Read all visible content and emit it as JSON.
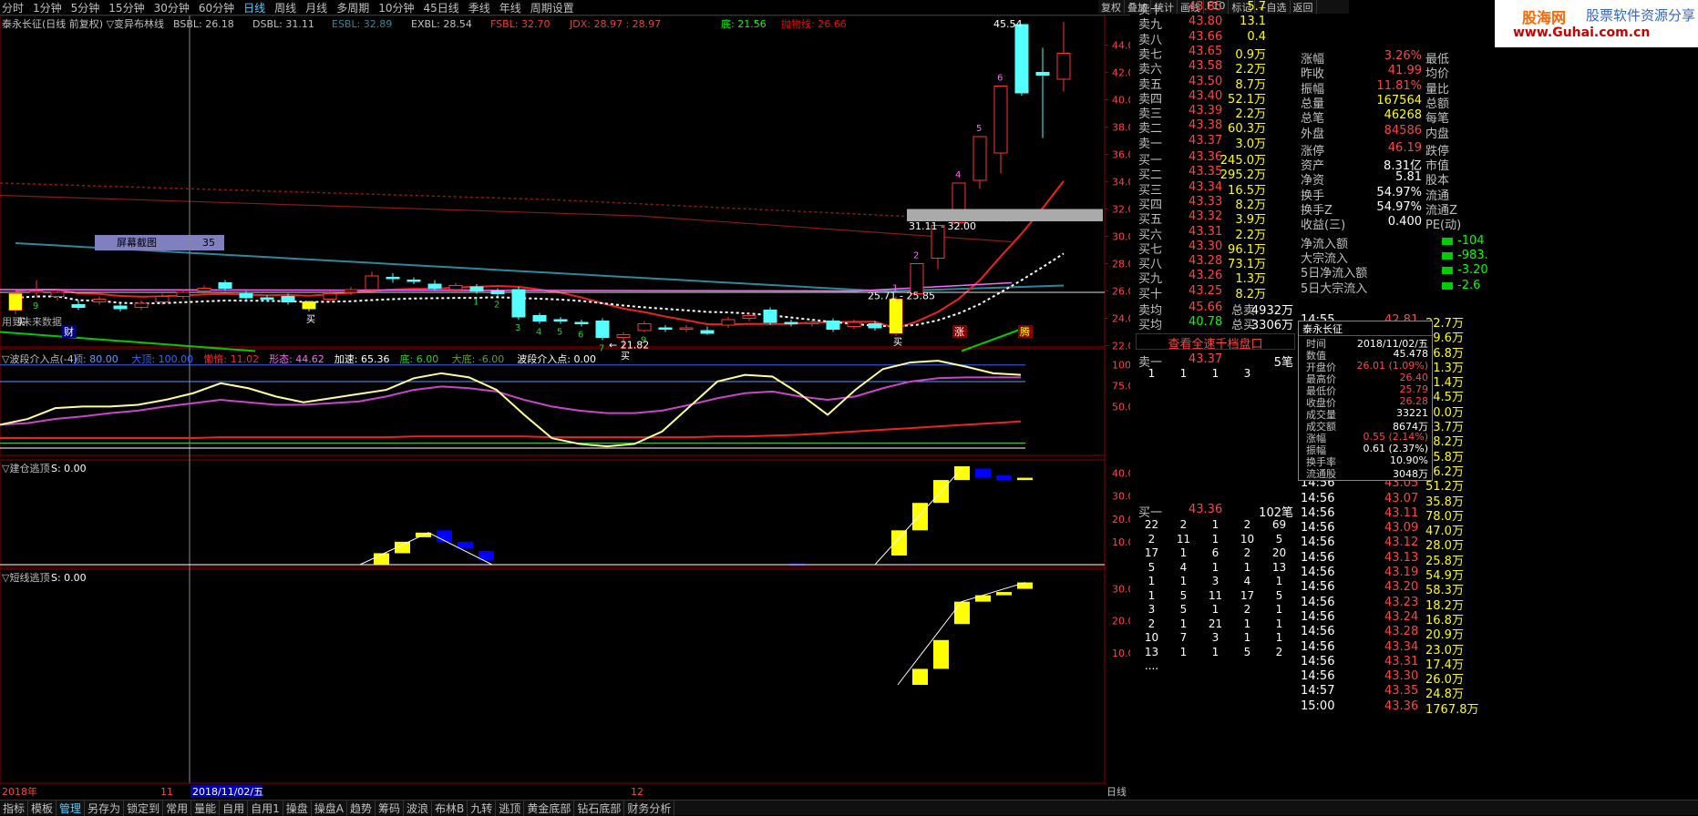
{
  "periods": [
    "分时",
    "1分钟",
    "5分钟",
    "15分钟",
    "30分钟",
    "60分钟",
    "日线",
    "周线",
    "月线",
    "多周期",
    "10分钟",
    "45日线",
    "季线",
    "年线",
    "周期设置"
  ],
  "active_period": "日线",
  "topright": [
    "复权",
    "叠加",
    "统计",
    "画线",
    "F10",
    "标记",
    "+自选",
    "返回"
  ],
  "brand": {
    "name": "股海网",
    "slogan": "股票软件资源分享",
    "url": "www.Guhai.com.cn"
  },
  "main_chart": {
    "title": "泰永长征(日线 前复权)",
    "indicator": "▽变异布林线",
    "values": [
      {
        "t": "BSBL: 26.18",
        "c": "#c0c0c0"
      },
      {
        "t": "DSBL: 31.11",
        "c": "#c0c0c0"
      },
      {
        "t": "ESBL: 32.89",
        "c": "#2a8a9a"
      },
      {
        "t": "EXBL: 28.54",
        "c": "#c0c0c0"
      },
      {
        "t": "FSBL: 32.70",
        "c": "#f33"
      },
      {
        "t": "JDX: 28.97 : 28.97",
        "c": "#d44"
      },
      {
        "t": "底: 21.56",
        "c": "#0f0"
      },
      {
        "t": "抛物线: 26.66",
        "c": "#f00"
      }
    ],
    "price_labels": [
      "44.00",
      "42.00",
      "40.00",
      "38.00",
      "36.00",
      "34.00",
      "32.00",
      "30.00",
      "28.00",
      "26.00",
      "24.00",
      "22.00"
    ],
    "annotations": {
      "high": "45.54",
      "low": "21.82",
      "band1": "31.11 - 32.00",
      "band2": "25.71 - 25.85",
      "screenshot_tool": "屏幕截图",
      "screenshot_val": "35",
      "future": "用到未来数据",
      "zhang": "涨",
      "teng": "腾",
      "cai": "财",
      "buy": "买"
    }
  },
  "chart_data": [
    {
      "type": "candlestick",
      "title": "泰永长征(日线 前复权)",
      "ylim": [
        21.5,
        45.5
      ],
      "candles": [
        {
          "o": 24.6,
          "c": 25.8,
          "h": 26.0,
          "l": 24.3
        },
        {
          "o": 25.9,
          "c": 26.0,
          "h": 26.8,
          "l": 25.5
        },
        {
          "o": 25.6,
          "c": 25.9,
          "h": 26.1,
          "l": 25.3
        },
        {
          "o": 25.0,
          "c": 24.8,
          "h": 25.3,
          "l": 24.6
        },
        {
          "o": 25.2,
          "c": 25.4,
          "h": 25.6,
          "l": 25.0
        },
        {
          "o": 24.9,
          "c": 24.7,
          "h": 25.1,
          "l": 24.5
        },
        {
          "o": 24.8,
          "c": 25.1,
          "h": 25.3,
          "l": 24.6
        },
        {
          "o": 25.2,
          "c": 25.6,
          "h": 25.8,
          "l": 25.0
        },
        {
          "o": 25.6,
          "c": 25.9,
          "h": 26.1,
          "l": 25.4
        },
        {
          "o": 26.0,
          "c": 26.2,
          "h": 26.4,
          "l": 25.8
        },
        {
          "o": 26.6,
          "c": 26.2,
          "h": 26.8,
          "l": 26.0
        },
        {
          "o": 25.8,
          "c": 25.5,
          "h": 26.0,
          "l": 25.2
        },
        {
          "o": 25.5,
          "c": 25.4,
          "h": 25.7,
          "l": 25.2
        },
        {
          "o": 25.6,
          "c": 25.2,
          "h": 25.8,
          "l": 25.0
        },
        {
          "o": 25.2,
          "c": 24.7,
          "h": 25.3,
          "l": 24.5
        },
        {
          "o": 25.4,
          "c": 25.8,
          "h": 26.0,
          "l": 25.2
        },
        {
          "o": 25.9,
          "c": 26.1,
          "h": 26.3,
          "l": 25.7
        },
        {
          "o": 26.1,
          "c": 27.1,
          "h": 27.4,
          "l": 26.0
        },
        {
          "o": 27.0,
          "c": 26.9,
          "h": 27.3,
          "l": 26.6
        },
        {
          "o": 26.8,
          "c": 26.7,
          "h": 27.0,
          "l": 26.5
        },
        {
          "o": 26.5,
          "c": 26.2,
          "h": 26.8,
          "l": 26.0
        },
        {
          "o": 26.1,
          "c": 26.4,
          "h": 26.6,
          "l": 25.9
        },
        {
          "o": 26.3,
          "c": 26.0,
          "h": 26.5,
          "l": 25.8
        },
        {
          "o": 26.0,
          "c": 25.8,
          "h": 26.2,
          "l": 25.6
        },
        {
          "o": 26.1,
          "c": 24.1,
          "h": 26.3,
          "l": 23.9
        },
        {
          "o": 24.2,
          "c": 23.8,
          "h": 24.4,
          "l": 23.6
        },
        {
          "o": 23.9,
          "c": 23.8,
          "h": 24.1,
          "l": 23.6
        },
        {
          "o": 23.7,
          "c": 23.6,
          "h": 23.9,
          "l": 23.4
        },
        {
          "o": 23.8,
          "c": 22.6,
          "h": 24.0,
          "l": 22.4
        },
        {
          "o": 22.6,
          "c": 22.8,
          "h": 23.0,
          "l": 21.8
        },
        {
          "o": 23.1,
          "c": 23.6,
          "h": 23.8,
          "l": 23.0
        },
        {
          "o": 23.3,
          "c": 23.2,
          "h": 23.5,
          "l": 23.0
        },
        {
          "o": 23.2,
          "c": 23.3,
          "h": 23.5,
          "l": 23.0
        },
        {
          "o": 23.1,
          "c": 22.9,
          "h": 23.4,
          "l": 22.8
        },
        {
          "o": 23.5,
          "c": 23.9,
          "h": 24.1,
          "l": 23.3
        },
        {
          "o": 24.0,
          "c": 24.2,
          "h": 24.4,
          "l": 23.8
        },
        {
          "o": 24.6,
          "c": 23.7,
          "h": 24.8,
          "l": 23.5
        },
        {
          "o": 23.7,
          "c": 23.6,
          "h": 23.9,
          "l": 23.4
        },
        {
          "o": 23.6,
          "c": 23.7,
          "h": 23.9,
          "l": 23.4
        },
        {
          "o": 23.8,
          "c": 23.2,
          "h": 24.0,
          "l": 23.0
        },
        {
          "o": 23.4,
          "c": 23.7,
          "h": 23.9,
          "l": 23.2
        },
        {
          "o": 23.6,
          "c": 23.3,
          "h": 23.8,
          "l": 23.1
        },
        {
          "o": 22.9,
          "c": 25.4,
          "h": 25.6,
          "l": 22.7
        },
        {
          "o": 25.8,
          "c": 28.0,
          "h": 28.0,
          "l": 25.8
        },
        {
          "o": 28.4,
          "c": 30.8,
          "h": 30.8,
          "l": 27.6
        },
        {
          "o": 31.0,
          "c": 33.9,
          "h": 33.9,
          "l": 30.7
        },
        {
          "o": 34.1,
          "c": 37.3,
          "h": 37.3,
          "l": 33.5
        },
        {
          "o": 36.1,
          "c": 41.0,
          "h": 41.0,
          "l": 34.6
        },
        {
          "o": 45.5,
          "c": 40.5,
          "h": 45.5,
          "l": 40.3
        },
        {
          "o": 42.0,
          "c": 41.8,
          "h": 43.8,
          "l": 37.2
        },
        {
          "o": 41.5,
          "c": 43.4,
          "h": 45.7,
          "l": 40.6
        }
      ]
    },
    {
      "type": "line",
      "title": "波段介入点(-4)",
      "ylim": [
        0,
        115
      ],
      "ticks": [
        "100.00",
        "75.00",
        "50.00"
      ]
    },
    {
      "type": "bar",
      "title": "建仓逃顶",
      "ylim": [
        0,
        45
      ],
      "ticks": [
        "40.00",
        "30.00",
        "20.00",
        "10.00"
      ]
    },
    {
      "type": "bar",
      "title": "短线逃顶",
      "ylim": [
        0,
        35
      ],
      "ticks": [
        "30.00",
        "20.00",
        "10.00"
      ]
    }
  ],
  "panel2": {
    "title": "▽波段介入点(-4)",
    "values": [
      {
        "t": "顶: 80.00",
        "c": "#69f"
      },
      {
        "t": "大顶: 100.00",
        "c": "#36f"
      },
      {
        "t": "懒惰: 11.02",
        "c": "#f22"
      },
      {
        "t": "形态: 44.62",
        "c": "#f6f"
      },
      {
        "t": "加速: 65.36",
        "c": "#fff"
      },
      {
        "t": "底: 6.00",
        "c": "#3c3"
      },
      {
        "t": "大底: -6.00",
        "c": "#693"
      },
      {
        "t": "波段介入点: 0.00",
        "c": "#fff"
      }
    ]
  },
  "panel3": {
    "title": "▽建仓逃顶",
    "sval": "S: 0.00"
  },
  "panel4": {
    "title": "▽短线逃顶",
    "sval": "S: 0.00"
  },
  "time_axis": [
    "2018年",
    "11",
    "2018/11/02/五",
    "12",
    "日线"
  ],
  "bottom_tabs": [
    "指标",
    "模板",
    "管理",
    "另存为",
    "锁定到",
    "常用",
    "量能",
    "自用",
    "自用1",
    "操盘",
    "操盘A",
    "趋势",
    "筹码",
    "波浪",
    "布林B",
    "九转",
    "逃顶",
    "黄金底部",
    "钻石底部",
    "财务分析"
  ],
  "active_tab": "管理",
  "orderbook": {
    "sell": [
      {
        "l": "卖十",
        "p": "43.85",
        "v": "5.7"
      },
      {
        "l": "卖九",
        "p": "43.80",
        "v": "13.1"
      },
      {
        "l": "卖八",
        "p": "43.66",
        "v": "0.4"
      },
      {
        "l": "卖七",
        "p": "43.65",
        "v": "0.9万"
      },
      {
        "l": "卖六",
        "p": "43.58",
        "v": "2.2万"
      },
      {
        "l": "卖五",
        "p": "43.50",
        "v": "8.7万"
      },
      {
        "l": "卖四",
        "p": "43.40",
        "v": "52.1万"
      },
      {
        "l": "卖三",
        "p": "43.39",
        "v": "2.2万"
      },
      {
        "l": "卖二",
        "p": "43.38",
        "v": "60.3万"
      },
      {
        "l": "卖一",
        "p": "43.37",
        "v": "3.0万"
      }
    ],
    "buy": [
      {
        "l": "买一",
        "p": "43.36",
        "v": "245.0万"
      },
      {
        "l": "买二",
        "p": "43.35",
        "v": "295.2万"
      },
      {
        "l": "买三",
        "p": "43.34",
        "v": "16.5万"
      },
      {
        "l": "买四",
        "p": "43.33",
        "v": "8.2万"
      },
      {
        "l": "买五",
        "p": "43.32",
        "v": "3.9万"
      },
      {
        "l": "买六",
        "p": "43.31",
        "v": "2.2万"
      },
      {
        "l": "买七",
        "p": "43.30",
        "v": "96.1万"
      },
      {
        "l": "买八",
        "p": "43.28",
        "v": "73.1万"
      },
      {
        "l": "买九",
        "p": "43.26",
        "v": "1.3万"
      },
      {
        "l": "买十",
        "p": "43.25",
        "v": "8.2万"
      }
    ],
    "avg_sell": {
      "l": "卖均",
      "p": "45.66",
      "k": "总卖",
      "v": "4932万"
    },
    "avg_buy": {
      "l": "买均",
      "p": "40.78",
      "k": "总买",
      "v": "3306万"
    },
    "full_btn": "查看全速千档盘口",
    "sell1": {
      "l": "卖一",
      "p": "43.37",
      "v": "5笔"
    },
    "sell1_grid": [
      "1",
      "1",
      "1",
      "3",
      ""
    ],
    "buy1": {
      "l": "买一",
      "p": "43.36",
      "v": "102笔"
    },
    "buy1_grid": [
      [
        "22",
        "2",
        "1",
        "2",
        "69"
      ],
      [
        "2",
        "11",
        "1",
        "10",
        "5"
      ],
      [
        "17",
        "1",
        "6",
        "2",
        "20"
      ],
      [
        "5",
        "4",
        "1",
        "1",
        "13"
      ],
      [
        "1",
        "1",
        "3",
        "4",
        "1"
      ],
      [
        "1",
        "5",
        "11",
        "17",
        "5"
      ],
      [
        "3",
        "5",
        "1",
        "2",
        "1"
      ],
      [
        "2",
        "1",
        "21",
        "1",
        "1"
      ],
      [
        "10",
        "7",
        "3",
        "1",
        "1"
      ],
      [
        "13",
        "1",
        "1",
        "5",
        "2"
      ],
      [
        "....",
        "",
        "",
        "",
        ""
      ]
    ]
  },
  "stock_info": [
    {
      "k": "涨幅",
      "v": "3.26%",
      "k2": "最低"
    },
    {
      "k": "昨收",
      "v": "41.99",
      "k2": "均价"
    },
    {
      "k": "振幅",
      "v": "11.81%",
      "k2": "量比"
    },
    {
      "k": "总量",
      "v": "167564",
      "k2": "总额"
    },
    {
      "k": "总笔",
      "v": "46268",
      "k2": "每笔"
    },
    {
      "k": "外盘",
      "v": "84586",
      "k2": "内盘"
    },
    {
      "k": "涨停",
      "v": "46.19",
      "k2": "跌停"
    },
    {
      "k": "资产",
      "v": "8.31亿",
      "k2": "市值"
    },
    {
      "k": "净资",
      "v": "5.81",
      "k2": "股本"
    },
    {
      "k": "换手",
      "v": "54.97%",
      "k2": "流通"
    },
    {
      "k": "换手Z",
      "v": "54.97%",
      "k2": "流通Z"
    },
    {
      "k": "收益(三)",
      "v": "0.400",
      "k2": "PE(动)"
    }
  ],
  "flows": [
    {
      "k": "净流入额",
      "v": "-104"
    },
    {
      "k": "大宗流入",
      "v": "-983."
    },
    {
      "k": "5日净流入额",
      "v": "-3.20"
    },
    {
      "k": "5日大宗流入",
      "v": "-2.6"
    }
  ],
  "popup": {
    "title": "泰永长征",
    "rows": [
      {
        "k": "时间",
        "v": "2018/11/02/五"
      },
      {
        "k": "数值",
        "v": "45.478"
      },
      {
        "k": "开盘价",
        "v": "26.01 (1.09%)"
      },
      {
        "k": "最高价",
        "v": "26.40"
      },
      {
        "k": "最低价",
        "v": "25.79"
      },
      {
        "k": "收盘价",
        "v": "26.28"
      },
      {
        "k": "成交量",
        "v": "33221"
      },
      {
        "k": "成交额",
        "v": "8674万"
      },
      {
        "k": "涨幅",
        "v": "0.55 (2.14%)"
      },
      {
        "k": "振幅",
        "v": "0.61 (2.37%)"
      },
      {
        "k": "换手率",
        "v": "10.90%"
      },
      {
        "k": "流通股",
        "v": "3048万"
      }
    ]
  },
  "ticks": [
    {
      "t": "14:55",
      "p": "42.81",
      "v": "22.7万"
    },
    {
      "t": "14:55",
      "p": "42.89",
      "v": "19.6万"
    },
    {
      "t": "14:55",
      "p": "42.89",
      "v": "26.8万"
    },
    {
      "t": "14:55",
      "p": "42.88",
      "v": "31.3万"
    },
    {
      "t": "14:55",
      "p": "42.88",
      "v": "21.4万"
    },
    {
      "t": "14:56",
      "p": "42.91",
      "v": "24.5万"
    },
    {
      "t": "14:56",
      "p": "42.98",
      "v": "30.0万"
    },
    {
      "t": "14:56",
      "p": "43.02",
      "v": "33.7万"
    },
    {
      "t": "14:56",
      "p": "43.04",
      "v": "38.2万"
    },
    {
      "t": "14:56",
      "p": "43.05",
      "v": "35.8万"
    },
    {
      "t": "14:56",
      "p": "43.06",
      "v": "36.2万"
    },
    {
      "t": "14:56",
      "p": "43.05",
      "v": "51.2万"
    },
    {
      "t": "14:56",
      "p": "43.07",
      "v": "35.8万"
    },
    {
      "t": "14:56",
      "p": "43.11",
      "v": "78.0万"
    },
    {
      "t": "14:56",
      "p": "43.09",
      "v": "47.0万"
    },
    {
      "t": "14:56",
      "p": "43.12",
      "v": "28.0万"
    },
    {
      "t": "14:56",
      "p": "43.13",
      "v": "25.8万"
    },
    {
      "t": "14:56",
      "p": "43.19",
      "v": "54.9万"
    },
    {
      "t": "14:56",
      "p": "43.20",
      "v": "58.3万"
    },
    {
      "t": "14:56",
      "p": "43.23",
      "v": "18.2万"
    },
    {
      "t": "14:56",
      "p": "43.24",
      "v": "16.8万"
    },
    {
      "t": "14:56",
      "p": "43.28",
      "v": "20.9万"
    },
    {
      "t": "14:56",
      "p": "43.34",
      "v": "23.0万"
    },
    {
      "t": "14:56",
      "p": "43.31",
      "v": "17.4万"
    },
    {
      "t": "14:56",
      "p": "43.30",
      "v": "26.0万"
    },
    {
      "t": "14:57",
      "p": "43.35",
      "v": "24.8万"
    },
    {
      "t": "15:00",
      "p": "43.36",
      "v": "1767.8万"
    }
  ]
}
